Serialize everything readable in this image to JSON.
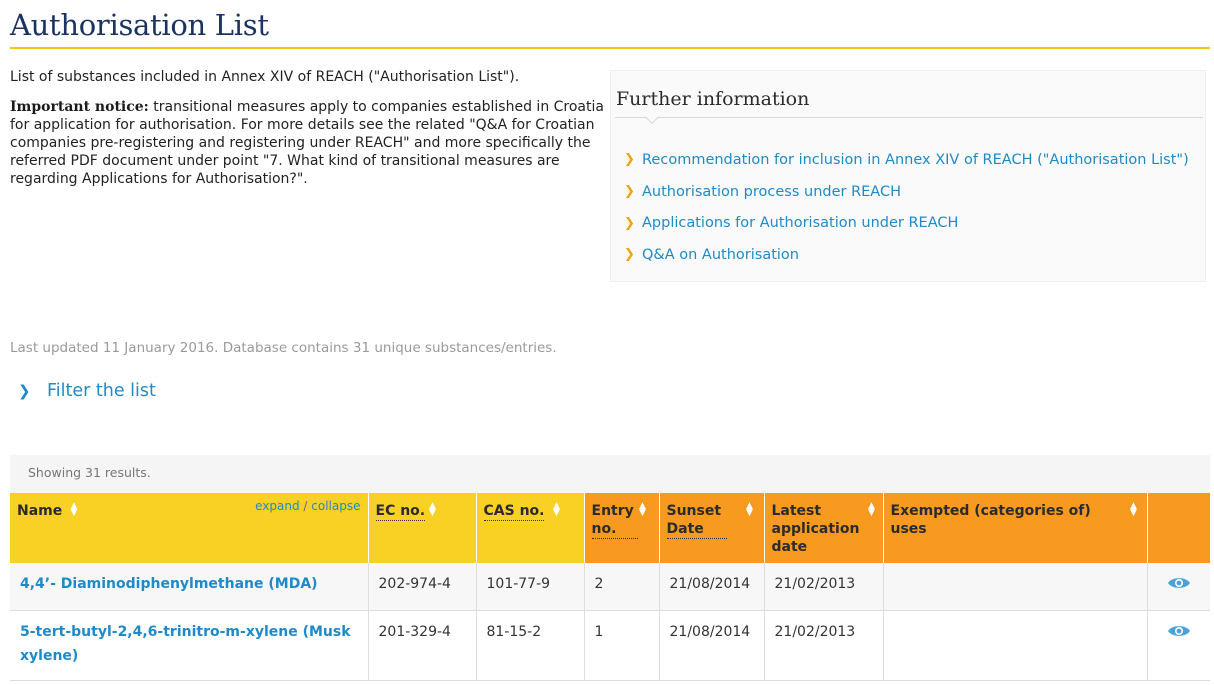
{
  "page": {
    "title": "Authorisation List"
  },
  "intro": {
    "lead": "List of substances included in Annex XIV of REACH (\"Authorisation List\").",
    "notice_label": "Important notice:",
    "notice_text": " transitional measures apply to companies established in Croatia for application for authorisation. For more details see the related \"Q&A for Croatian companies pre-registering and registering under REACH\" and more specifically the referred PDF document under point \"7. What kind of transitional measures are regarding Applications for Authorisation?\"."
  },
  "further_info": {
    "heading": "Further information",
    "links": [
      {
        "label": "Recommendation for inclusion in Annex XIV of REACH (\"Authorisation List\")"
      },
      {
        "label": "Authorisation process under REACH"
      },
      {
        "label": "Applications for Authorisation under REACH"
      },
      {
        "label": "Q&A on Authorisation"
      }
    ]
  },
  "meta": {
    "updated": "Last updated 11 January 2016. Database contains 31 unique substances/entries."
  },
  "filter": {
    "label": "Filter the list"
  },
  "results": {
    "summary": "Showing 31 results.",
    "expand_label": "expand",
    "separator": " / ",
    "collapse_label": "collapse",
    "columns": {
      "name": "Name",
      "ec": "EC no.",
      "cas": "CAS no.",
      "entry": "Entry no.",
      "sunset": "Sunset Date",
      "latest": "Latest application date",
      "exempted": "Exempted (categories of) uses"
    },
    "rows": [
      {
        "name": "4,4’- Diaminodiphenylmethane (MDA)",
        "ec": "202-974-4",
        "cas": "101-77-9",
        "entry": "2",
        "sunset": "21/08/2014",
        "latest": "21/02/2013",
        "exempted": ""
      },
      {
        "name": "5-tert-butyl-2,4,6-trinitro-m-xylene (Musk xylene)",
        "ec": "201-329-4",
        "cas": "81-15-2",
        "entry": "1",
        "sunset": "21/08/2014",
        "latest": "21/02/2013",
        "exempted": ""
      }
    ]
  },
  "icons": {
    "further_chevron": "chevron-right-icon",
    "filter_chevron": "chevron-right-icon",
    "sort": "sort-up-down-icon",
    "view": "eye-icon"
  },
  "colors": {
    "title": "#1c3361",
    "accent_yellow": "#f9d024",
    "accent_orange": "#f79a1f",
    "link": "#1e8ac9"
  }
}
